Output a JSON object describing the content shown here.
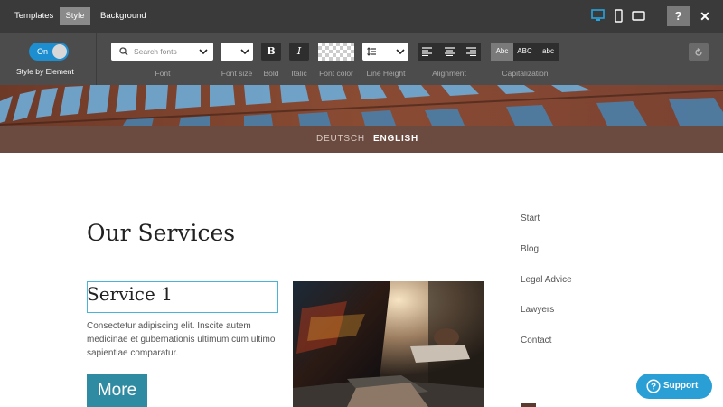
{
  "topbar": {
    "tabs": [
      {
        "label": "Templates"
      },
      {
        "label": "Style",
        "active": true
      },
      {
        "label": "Background"
      }
    ],
    "devices": [
      "desktop-icon",
      "mobile-icon",
      "tablet-icon"
    ],
    "help_label": "?",
    "close_label": "✕"
  },
  "toolbar": {
    "toggle_label": "On",
    "style_by_element": "Style by Element",
    "font_placeholder": "Search fonts",
    "bold_label": "B",
    "italic_label": "I",
    "labels": {
      "font": "Font",
      "font_size": "Font size",
      "bold": "Bold",
      "italic": "Italic",
      "font_color": "Font color",
      "line_height": "Line Height",
      "alignment": "Alignment",
      "capitalization": "Capitalization"
    },
    "capitalization": [
      {
        "label": "Abc",
        "selected": true
      },
      {
        "label": "ABC"
      },
      {
        "label": "abc"
      }
    ],
    "accent_color": "#1d8fd0"
  },
  "site": {
    "languages": [
      {
        "label": "DEUTSCH"
      },
      {
        "label": "ENGLISH",
        "active": true
      }
    ],
    "heading": "Our Services",
    "service_title": "Service 1",
    "service_text": "Consectetur adipiscing elit. Inscite autem medicinae et gubernationis ultimum cum ultimo sapientiae comparatur.",
    "more_label": "More",
    "sidebar": [
      {
        "label": "Start"
      },
      {
        "label": "Blog"
      },
      {
        "label": "Legal Advice"
      },
      {
        "label": "Lawyers"
      },
      {
        "label": "Contact"
      }
    ]
  },
  "support_label": "Support"
}
